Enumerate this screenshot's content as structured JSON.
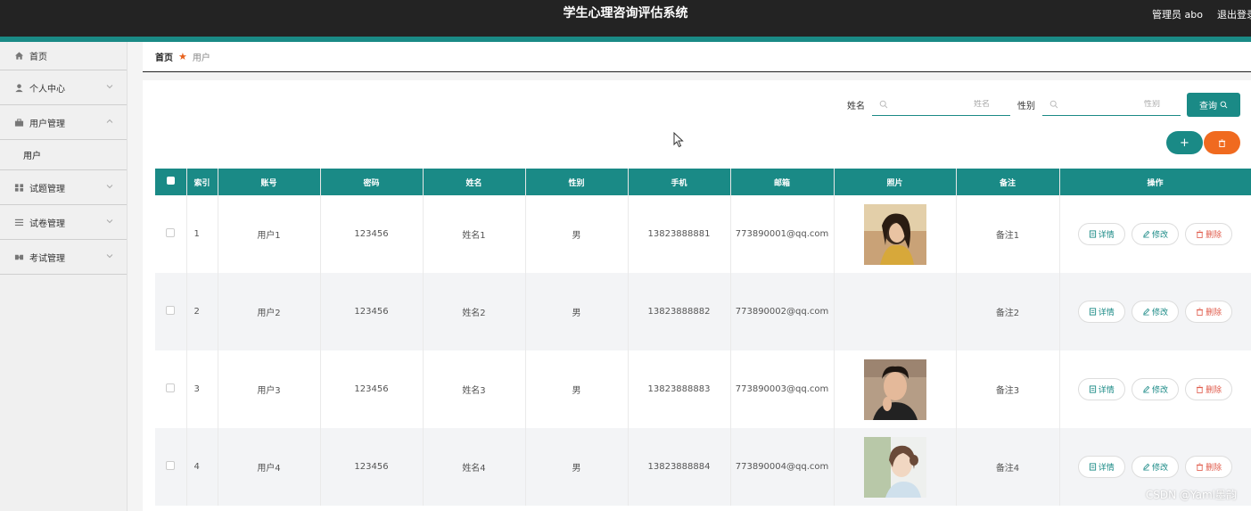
{
  "header": {
    "title": "学生心理咨询评估系统",
    "user": "管理员 abo",
    "logout": "退出登录"
  },
  "sidebar": {
    "items": [
      {
        "label": "首页",
        "icon": "home-icon"
      },
      {
        "label": "个人中心",
        "icon": "person-icon"
      },
      {
        "label": "用户管理",
        "icon": "users-icon",
        "expanded": true,
        "children": [
          "用户"
        ]
      },
      {
        "label": "试题管理",
        "icon": "grid-icon"
      },
      {
        "label": "试卷管理",
        "icon": "list-icon"
      },
      {
        "label": "考试管理",
        "icon": "exam-icon"
      }
    ]
  },
  "breadcrumb": {
    "home": "首页",
    "current": "用户"
  },
  "search": {
    "name_label": "姓名",
    "name_placeholder": "姓名",
    "gender_label": "性别",
    "gender_placeholder": "性别",
    "query_label": "查询"
  },
  "toolbar": {
    "add": "+",
    "delete_icon": "trash-icon"
  },
  "table": {
    "headers": [
      "索引",
      "账号",
      "密码",
      "姓名",
      "性别",
      "手机",
      "邮箱",
      "照片",
      "备注",
      "操作"
    ],
    "rows": [
      {
        "index": "1",
        "account": "用户1",
        "password": "123456",
        "name": "姓名1",
        "gender": "男",
        "phone": "13823888881",
        "email": "773890001@qq.com",
        "photo": "woman-portrait",
        "note": "备注1"
      },
      {
        "index": "2",
        "account": "用户2",
        "password": "123456",
        "name": "姓名2",
        "gender": "男",
        "phone": "13823888882",
        "email": "773890002@qq.com",
        "photo": "",
        "note": "备注2"
      },
      {
        "index": "3",
        "account": "用户3",
        "password": "123456",
        "name": "姓名3",
        "gender": "男",
        "phone": "13823888883",
        "email": "773890003@qq.com",
        "photo": "man-portrait",
        "note": "备注3"
      },
      {
        "index": "4",
        "account": "用户4",
        "password": "123456",
        "name": "姓名4",
        "gender": "男",
        "phone": "13823888884",
        "email": "773890004@qq.com",
        "photo": "girl-portrait",
        "note": "备注4"
      }
    ],
    "actions": {
      "detail": "详情",
      "edit": "修改",
      "delete": "删除"
    }
  },
  "watermark": "CSDN @Yaml墨韵",
  "colors": {
    "primary": "#1a8a86",
    "danger": "#f06a1f",
    "header_bg": "#232323"
  }
}
